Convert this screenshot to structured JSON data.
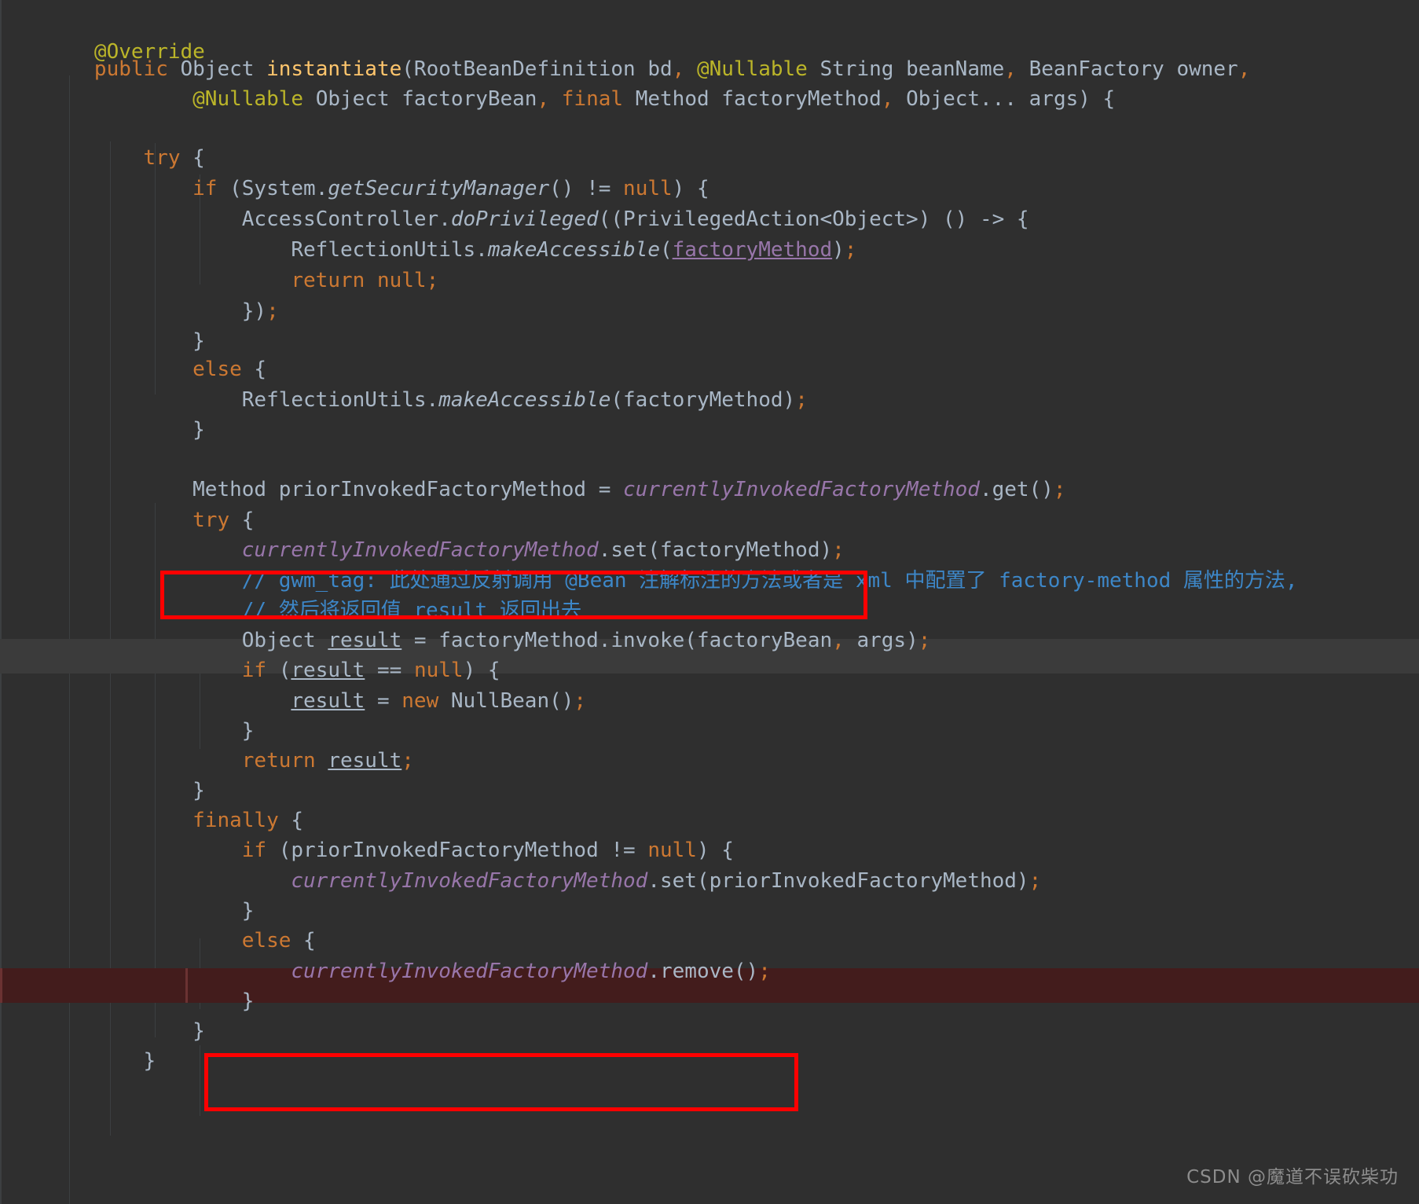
{
  "app": {
    "kind": "code-editor",
    "theme": "darcula",
    "background": "#2f2f2f",
    "foreground": "#a9b7c6"
  },
  "colors": {
    "keyword": "#cc7832",
    "annotation": "#bbb529",
    "method_declaration": "#ffc66d",
    "static_field": "#9876aa",
    "comment": "#3d87c8",
    "identifier": "#a9b7c6",
    "annotation_box": "#ff0000",
    "execution_line_highlight": "#431c1c",
    "caret_line_highlight": "#3b3b3b",
    "watermark": "#8d8d8d"
  },
  "code": {
    "language": "Java",
    "lines": [
      {
        "indent": 0,
        "text": "@Override"
      },
      {
        "indent": 0,
        "text": "public Object instantiate(RootBeanDefinition bd, @Nullable String beanName, BeanFactory owner,"
      },
      {
        "indent": 0,
        "text": "        @Nullable Object factoryBean, final Method factoryMethod, Object... args) {"
      },
      {
        "indent": 0,
        "text": ""
      },
      {
        "indent": 0,
        "text": "    try {"
      },
      {
        "indent": 0,
        "text": "        if (System.getSecurityManager() != null) {"
      },
      {
        "indent": 0,
        "text": "            AccessController.doPrivileged((PrivilegedAction<Object>) () -> {"
      },
      {
        "indent": 0,
        "text": "                ReflectionUtils.makeAccessible(factoryMethod);"
      },
      {
        "indent": 0,
        "text": "                return null;"
      },
      {
        "indent": 0,
        "text": "            });"
      },
      {
        "indent": 0,
        "text": "        }"
      },
      {
        "indent": 0,
        "text": "        else {"
      },
      {
        "indent": 0,
        "text": "            ReflectionUtils.makeAccessible(factoryMethod);"
      },
      {
        "indent": 0,
        "text": "        }"
      },
      {
        "indent": 0,
        "text": ""
      },
      {
        "indent": 0,
        "text": "        Method priorInvokedFactoryMethod = currentlyInvokedFactoryMethod.get();"
      },
      {
        "indent": 0,
        "text": "        try {"
      },
      {
        "indent": 0,
        "text": "            currentlyInvokedFactoryMethod.set(factoryMethod);"
      },
      {
        "indent": 0,
        "text": "            // gwm_tag: 此处通过反射调用 @Bean 注解标注的方法或者是 xml 中配置了 factory-method 属性的方法,"
      },
      {
        "indent": 0,
        "text": "            // 然后将返回值 result 返回出去"
      },
      {
        "indent": 0,
        "text": "            Object result = factoryMethod.invoke(factoryBean, args);"
      },
      {
        "indent": 0,
        "text": "            if (result == null) {"
      },
      {
        "indent": 0,
        "text": "                result = new NullBean();"
      },
      {
        "indent": 0,
        "text": "            }"
      },
      {
        "indent": 0,
        "text": "            return result;"
      },
      {
        "indent": 0,
        "text": "        }"
      },
      {
        "indent": 0,
        "text": "        finally {"
      },
      {
        "indent": 0,
        "text": "            if (priorInvokedFactoryMethod != null) {"
      },
      {
        "indent": 0,
        "text": "                currentlyInvokedFactoryMethod.set(priorInvokedFactoryMethod);"
      },
      {
        "indent": 0,
        "text": "            }"
      },
      {
        "indent": 0,
        "text": "            else {"
      },
      {
        "indent": 0,
        "text": "                currentlyInvokedFactoryMethod.remove();"
      },
      {
        "indent": 0,
        "text": "            }"
      },
      {
        "indent": 0,
        "text": "        }"
      },
      {
        "indent": 0,
        "text": "    }"
      }
    ]
  },
  "annotations": {
    "boxes": [
      {
        "label": "highlight-set-factory-method",
        "line_text": "currentlyInvokedFactoryMethod.set(factoryMethod);"
      },
      {
        "label": "highlight-remove",
        "line_text": "currentlyInvokedFactoryMethod.remove();"
      }
    ],
    "execution_line": "currentlyInvokedFactoryMethod.set(priorInvokedFactoryMethod);",
    "caret_line": "// 然后将返回值 result 返回出去"
  },
  "watermark": {
    "text": "CSDN @魔道不误砍柴功"
  }
}
